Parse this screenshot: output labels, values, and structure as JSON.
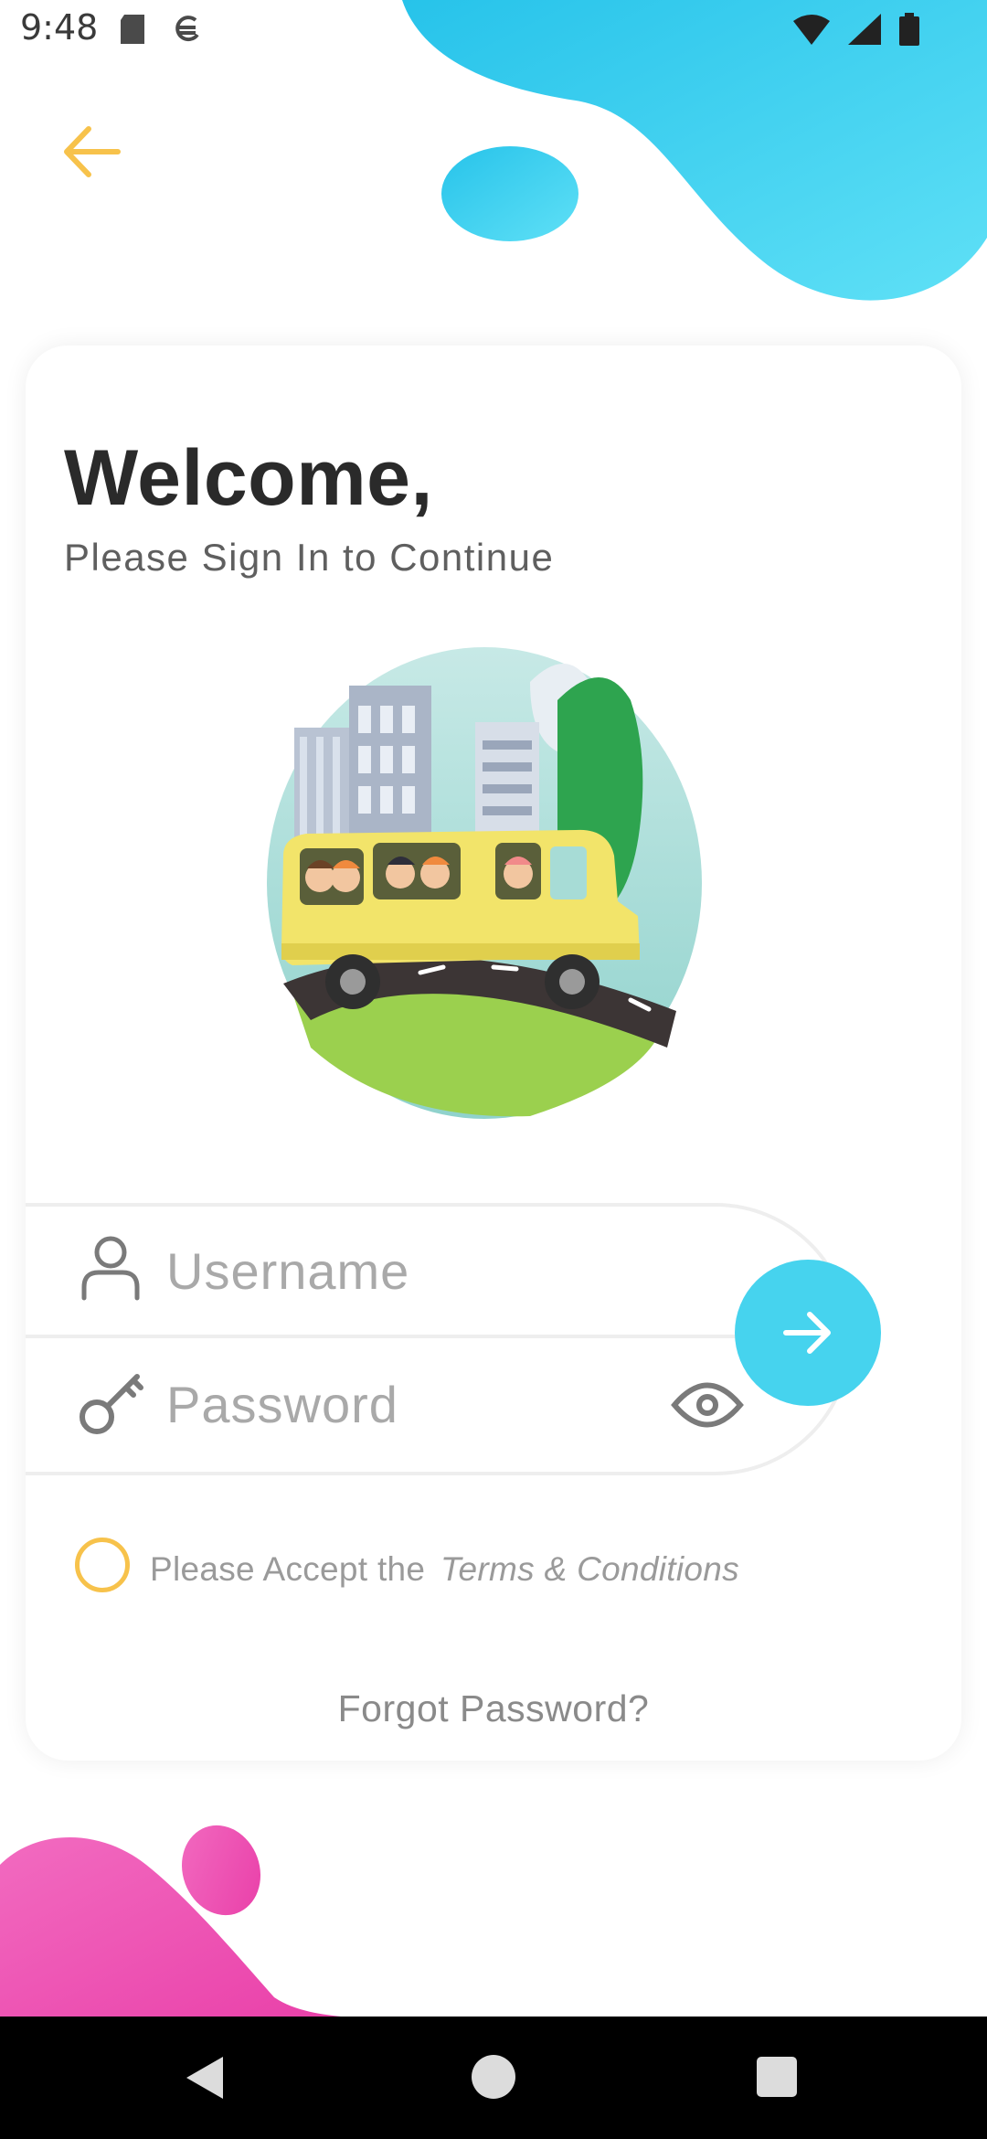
{
  "status_bar": {
    "time": "9:48",
    "left_icons": [
      "sd-card-icon",
      "sync-icon"
    ],
    "right_icons": [
      "wifi-icon",
      "signal-icon",
      "battery-icon"
    ]
  },
  "header": {
    "back_icon": "arrow-left-icon"
  },
  "welcome": {
    "title": "Welcome,",
    "subtitle": "Please Sign In to Continue"
  },
  "illustration": {
    "description_icon": "school-bus-illustration"
  },
  "form": {
    "username_placeholder": "Username",
    "username_value": "",
    "password_placeholder": "Password",
    "password_value": "",
    "submit_icon": "arrow-right-icon"
  },
  "terms": {
    "prefix": "Please Accept the",
    "link": "Terms & Conditions",
    "checked": false
  },
  "forgot_password": "Forgot Password?",
  "colors": {
    "accent_yellow": "#f7c24b",
    "accent_cyan": "#46d3ee",
    "accent_pink": "#f04fb0"
  },
  "nav_bar": [
    "back-triangle-icon",
    "home-circle-icon",
    "recents-square-icon"
  ]
}
